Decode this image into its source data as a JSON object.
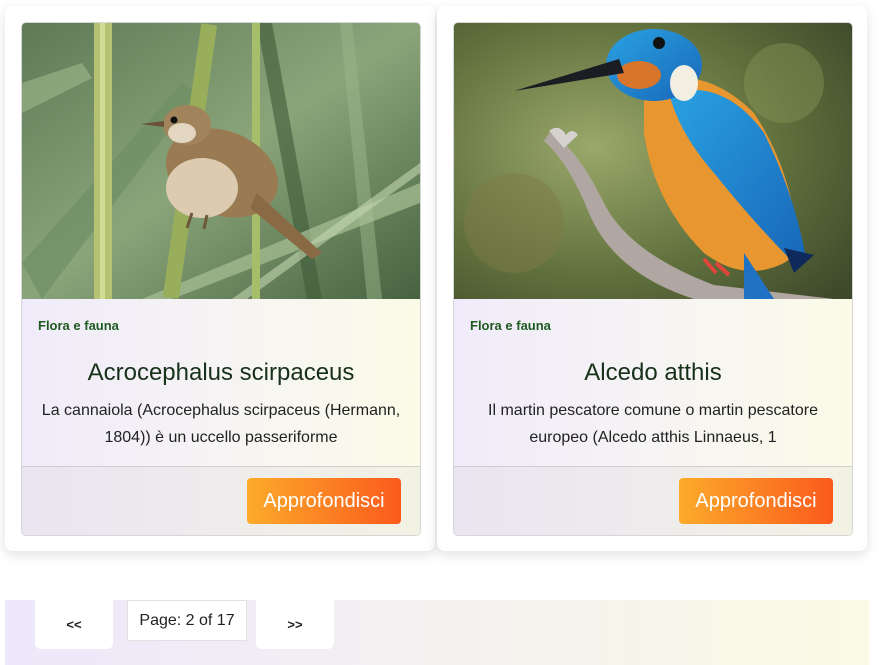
{
  "cards": [
    {
      "category": "Flora e fauna",
      "title": "Acrocephalus scirpaceus",
      "description": "La cannaiola (Acrocephalus scirpaceus (Hermann, 1804)) è un uccello passeriforme",
      "button_label": "Approfondisci"
    },
    {
      "category": "Flora e fauna",
      "title": "Alcedo atthis",
      "description": "Il martin pescatore comune o martin pescatore europeo (Alcedo atthis Linnaeus, 1",
      "button_label": "Approfondisci"
    }
  ],
  "pagination": {
    "prev_label": "<<",
    "page_label": "Page: 2 of 17",
    "next_label": ">>"
  },
  "colors": {
    "button_gradient_start": "#fbab2a",
    "button_gradient_end": "#fb5a1c",
    "category_text": "#1f5a1f",
    "title_text": "#17301a"
  }
}
